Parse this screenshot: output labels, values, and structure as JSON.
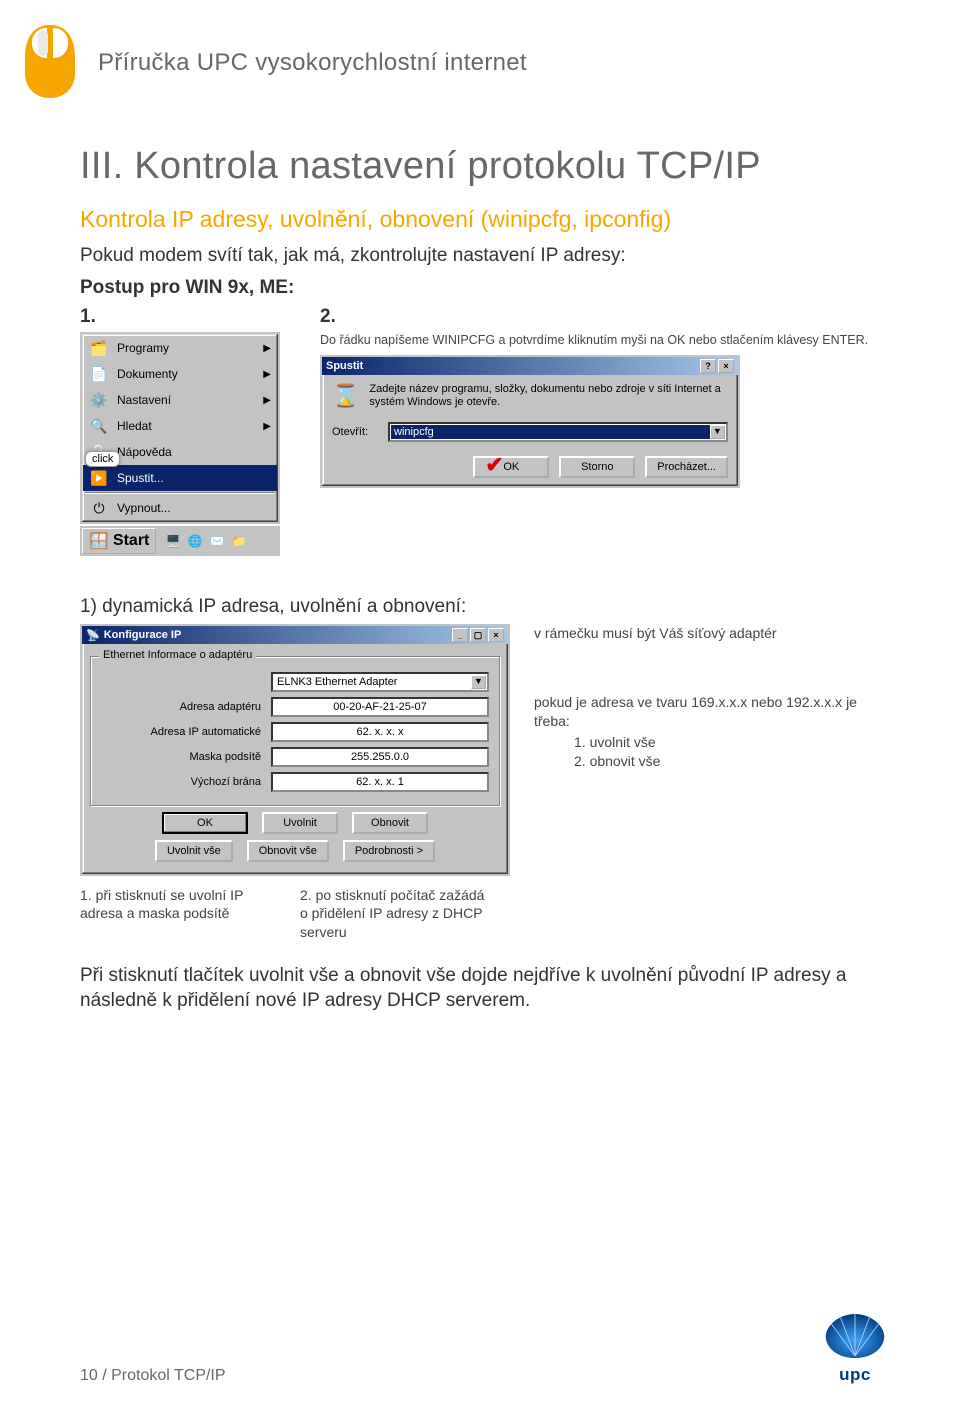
{
  "guide_title": "Příručka UPC vysokorychlostní internet",
  "main_heading": "III. Kontrola nastavení protokolu TCP/IP",
  "sub_heading": "Kontrola IP adresy, uvolnění, obnovení (winipcfg, ipconfig)",
  "intro1": "Pokud modem svítí tak, jak má, zkontrolujte nastavení IP adresy:",
  "intro2": "Postup pro WIN 9x, ME:",
  "step1_num": "1.",
  "step2_num": "2.",
  "startmenu": {
    "programy": "Programy",
    "dokumenty": "Dokumenty",
    "nastaveni": "Nastavení",
    "hledat": "Hledat",
    "napoveda": "Nápověda",
    "spustit": "Spustit...",
    "vypnout": "Vypnout...",
    "click": "click",
    "start": "Start"
  },
  "run": {
    "note": "Do řádku napíšeme WINIPCFG a potvrdíme kliknutím myši na OK nebo stlačením klávesy ENTER.",
    "title": "Spustit",
    "desc": "Zadejte název programu, složky, dokumentu nebo zdroje v síti Internet a systém Windows je otevře.",
    "field_label": "Otevřít:",
    "field_value": "winipcfg",
    "btn_ok": "OK",
    "btn_cancel": "Storno",
    "btn_browse": "Procházet..."
  },
  "dyn_heading": "1) dynamická IP adresa, uvolnění a obnovení:",
  "cfg": {
    "title": "Konfigurace IP",
    "group": "Ethernet Informace o adaptéru",
    "adapter_value": "ELNK3 Ethernet Adapter",
    "row1_label": "Adresa adaptéru",
    "row1_val": "00-20-AF-21-25-07",
    "row2_label": "Adresa IP automatické",
    "row2_val": "62. x. x. x",
    "row3_label": "Maska podsítě",
    "row3_val": "255.255.0.0",
    "row4_label": "Výchozí brána",
    "row4_val": "62. x. x. 1",
    "btn_ok": "OK",
    "btn_uvolnit": "Uvolnit",
    "btn_obnovit": "Obnovit",
    "btn_uvolnit_vse": "Uvolnit vše",
    "btn_obnovit_vse": "Obnovit vše",
    "btn_podrobnosti": "Podrobnosti >"
  },
  "side_note1": "v rámečku musí být Váš síťový adaptér",
  "side_note2": "pokud je adresa ve tvaru 169.x.x.x nebo 192.x.x.x je třeba:",
  "side_note2_a": "1. uvolnit vše",
  "side_note2_b": "2. obnovit vše",
  "annot1": "1. při stisknutí se uvolní IP adresa a maska podsítě",
  "annot2": "2. po stisknutí počítač zažádá o přidělení IP adresy z DHCP serveru",
  "after_text": "Při stisknutí tlačítek uvolnit vše a obnovit vše dojde nejdříve k uvolnění původní IP adresy a následně k přidělení nové IP adresy DHCP serverem.",
  "footer": "10 / Protokol TCP/IP",
  "brand": "upc"
}
